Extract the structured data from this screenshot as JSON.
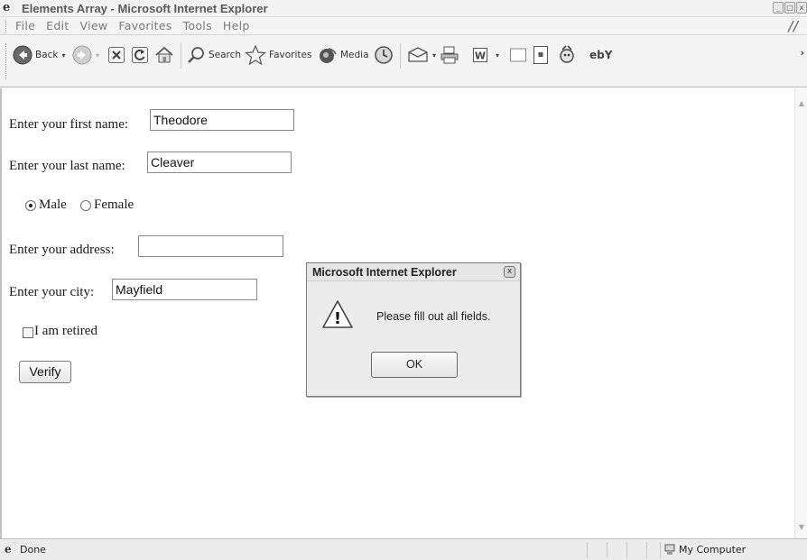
{
  "window": {
    "title": "Elements Array - Microsoft Internet Explorer",
    "icon_glyph": "e",
    "controls": {
      "minimize": "_",
      "maximize": "□",
      "close": "x"
    }
  },
  "menubar": {
    "items": [
      "File",
      "Edit",
      "View",
      "Favorites",
      "Tools",
      "Help"
    ],
    "logo_glyph": "//"
  },
  "toolbar": {
    "back_label": "Back",
    "search_label": "Search",
    "favorites_label": "Favorites",
    "media_label": "Media",
    "overflow_glyph": "›",
    "caret_glyph": "▾",
    "word_glyph": "W",
    "messenger_glyph": "ebY"
  },
  "form": {
    "first_name_label": "Enter your first name:",
    "first_name_value": "Theodore",
    "last_name_label": "Enter your last name:",
    "last_name_value": "Cleaver",
    "gender_male_label": "Male",
    "gender_female_label": "Female",
    "gender_selected": "Male",
    "address_label": "Enter your address:",
    "address_value": "",
    "city_label": "Enter your city:",
    "city_value": "Mayfield",
    "retired_label": "I am retired",
    "retired_checked": false,
    "verify_label": "Verify"
  },
  "dialog": {
    "title": "Microsoft Internet Explorer",
    "message": "Please fill out all fields.",
    "ok_label": "OK",
    "close_glyph": "x",
    "warning_glyph": "!"
  },
  "statusbar": {
    "status_text": "Done",
    "zone_text": "My Computer",
    "icon_glyph": "e"
  },
  "scrollbar": {
    "up_glyph": "▲",
    "down_glyph": "▼"
  }
}
